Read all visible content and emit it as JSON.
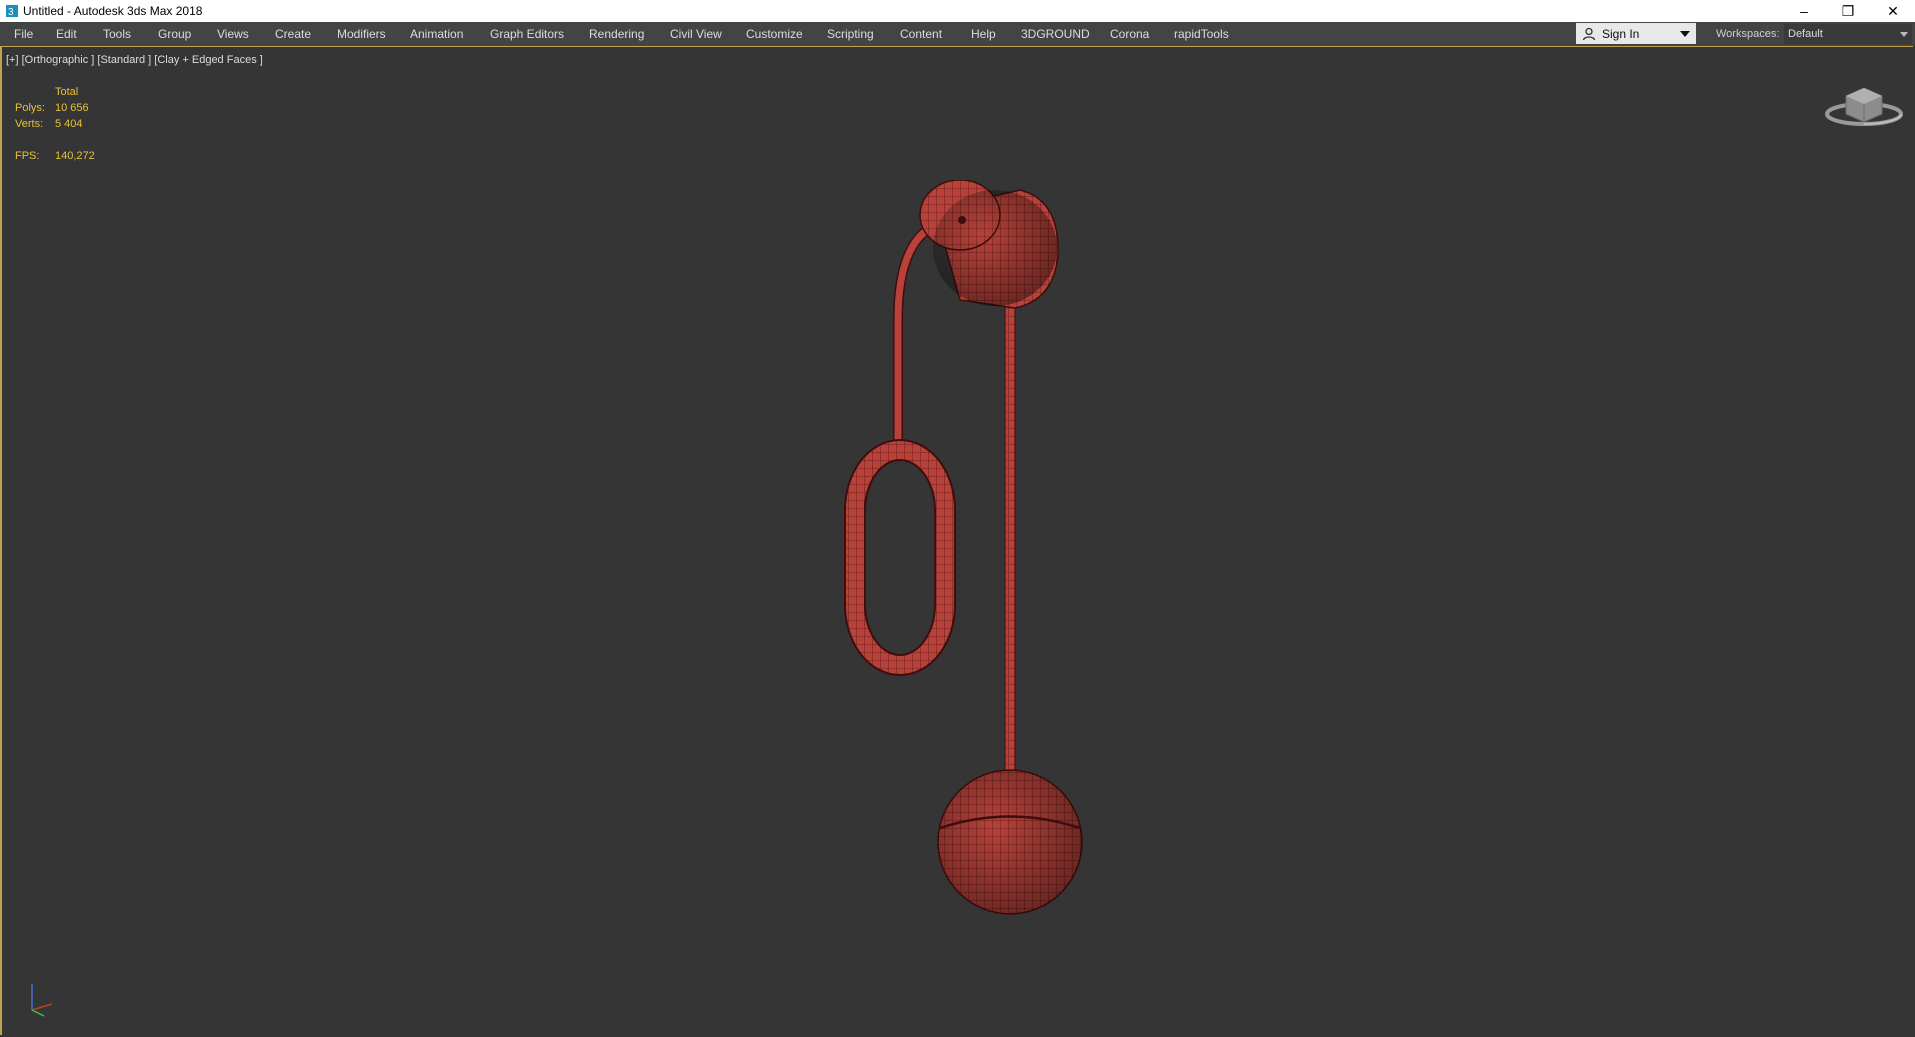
{
  "window": {
    "title": "Untitled - Autodesk 3ds Max 2018",
    "controls": {
      "minimize": "–",
      "restore": "❐",
      "close": "✕"
    }
  },
  "menu": {
    "items": [
      "File",
      "Edit",
      "Tools",
      "Group",
      "Views",
      "Create",
      "Modifiers",
      "Animation",
      "Graph Editors",
      "Rendering",
      "Civil View",
      "Customize",
      "Scripting",
      "Content",
      "Help",
      "3DGROUND",
      "Corona",
      "rapidTools"
    ]
  },
  "account": {
    "signin_label": "Sign In",
    "icon": "user-icon"
  },
  "workspace": {
    "label": "Workspaces:",
    "value": "Default"
  },
  "viewport": {
    "label": "[+] [Orthographic ] [Standard ] [Clay + Edged Faces ]",
    "stats": {
      "header": "Total",
      "polys_label": "Polys:",
      "polys_value": "10 656",
      "verts_label": "Verts:",
      "verts_value": "5 404",
      "fps_label": "FPS:",
      "fps_value": "140,272"
    },
    "model_color": "#b8413a",
    "model_edge_color": "#5a1412",
    "accent_color": "#bfa44b",
    "stats_color": "#e6c23a"
  }
}
